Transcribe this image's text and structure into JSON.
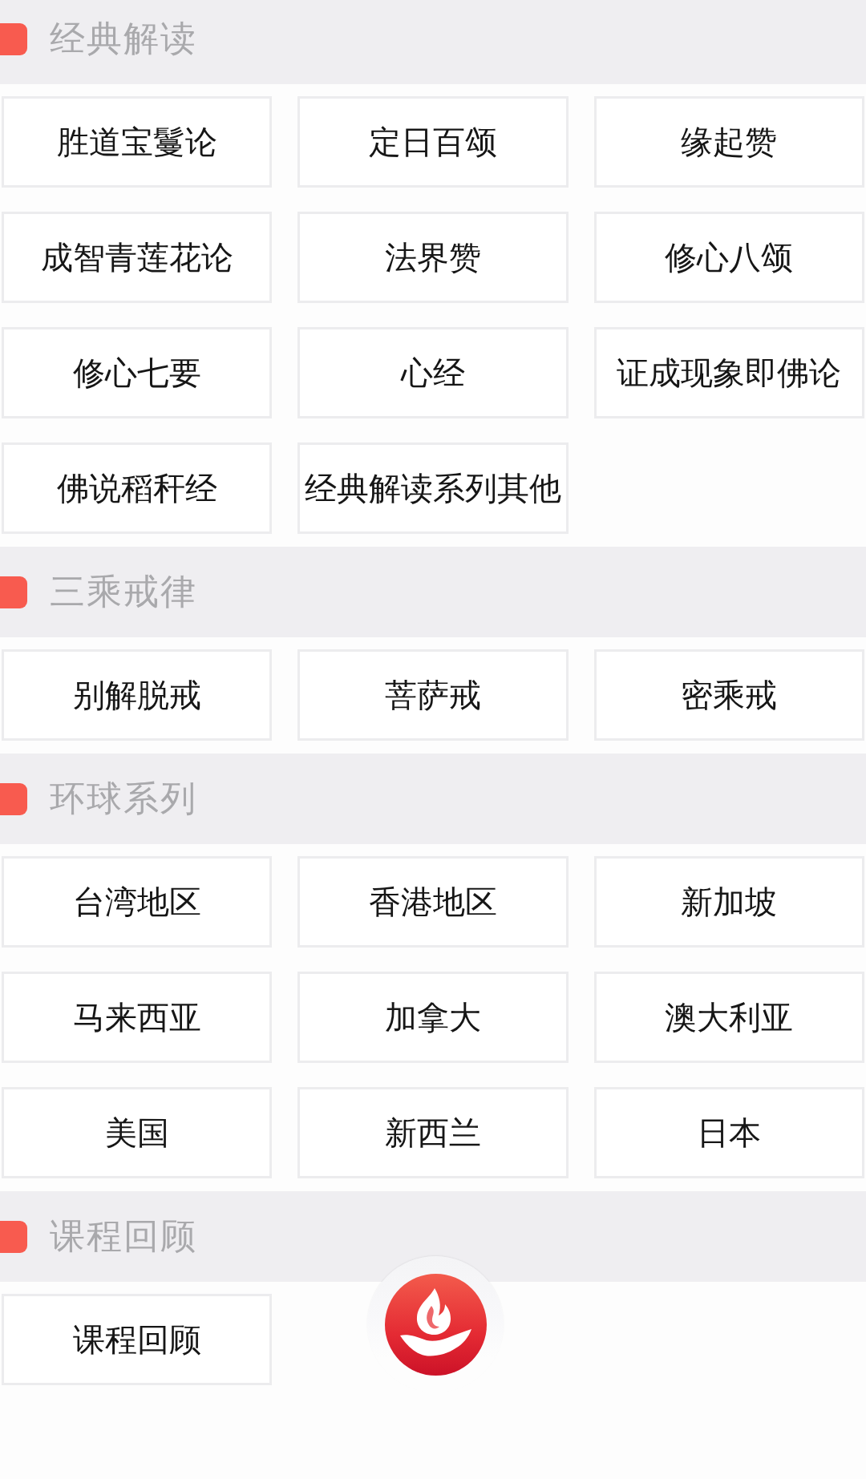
{
  "sections": [
    {
      "title": "经典解读",
      "items": [
        "胜道宝鬘论",
        "定日百颂",
        "缘起赞",
        "成智青莲花论",
        "法界赞",
        "修心八颂",
        "修心七要",
        "心经",
        "证成现象即佛论",
        "佛说稻秆经",
        "经典解读系列其他"
      ]
    },
    {
      "title": "三乘戒律",
      "items": [
        "别解脱戒",
        "菩萨戒",
        "密乘戒"
      ]
    },
    {
      "title": "环球系列",
      "items": [
        "台湾地区",
        "香港地区",
        "新加坡",
        "马来西亚",
        "加拿大",
        "澳大利亚",
        "美国",
        "新西兰",
        "日本"
      ]
    },
    {
      "title": "课程回顾",
      "items": [
        "课程回顾"
      ]
    }
  ]
}
